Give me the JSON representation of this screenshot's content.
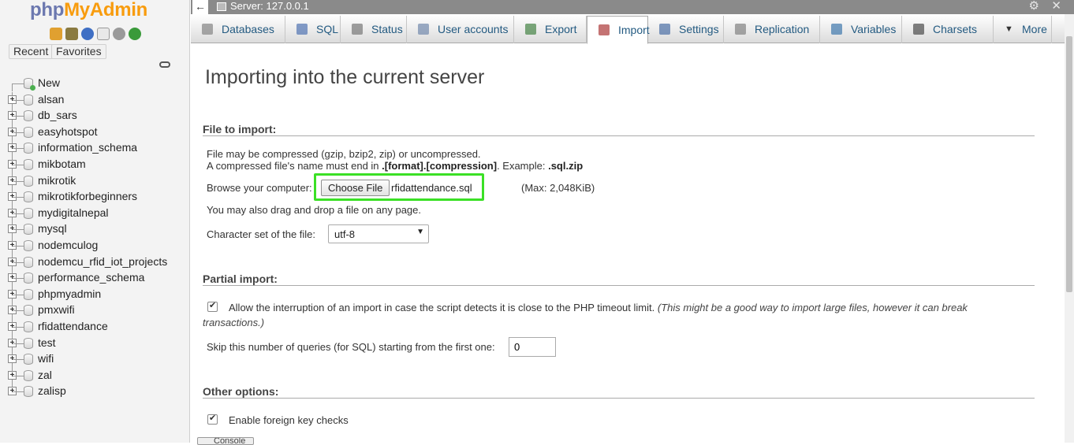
{
  "navigation": {
    "logo_part1": "php",
    "logo_part2": "MyAdmin",
    "icons": [
      "home-icon",
      "logout-icon",
      "help-icon",
      "docs-icon",
      "settings-icon",
      "reload-icon"
    ],
    "recent_label": "Recent",
    "favorites_label": "Favorites",
    "new_label": "New",
    "databases": [
      "alsan",
      "db_sars",
      "easyhotspot",
      "information_schema",
      "mikbotam",
      "mikrotik",
      "mikrotikforbeginners",
      "mydigitalnepal",
      "mysql",
      "nodemculog",
      "nodemcu_rfid_iot_projects",
      "performance_schema",
      "phpmyadmin",
      "pmxwifi",
      "rfidattendance",
      "test",
      "wifi",
      "zal",
      "zalisp"
    ]
  },
  "topbar": {
    "back": "←",
    "server_label": "Server: 127.0.0.1",
    "gear": "⚙",
    "close": "✕"
  },
  "tabs": [
    {
      "label": "Databases",
      "icon": "database-icon"
    },
    {
      "label": "SQL",
      "icon": "sql-icon"
    },
    {
      "label": "Status",
      "icon": "status-icon"
    },
    {
      "label": "User accounts",
      "icon": "users-icon"
    },
    {
      "label": "Export",
      "icon": "export-icon"
    },
    {
      "label": "Import",
      "icon": "import-icon",
      "active": true
    },
    {
      "label": "Settings",
      "icon": "wrench-icon"
    },
    {
      "label": "Replication",
      "icon": "replication-icon"
    },
    {
      "label": "Variables",
      "icon": "variables-icon"
    },
    {
      "label": "Charsets",
      "icon": "charsets-icon"
    },
    {
      "label": "More",
      "icon": "caret-down-icon"
    }
  ],
  "main": {
    "title": "Importing into the current server",
    "file_section": {
      "heading": "File to import:",
      "line1": "File may be compressed (gzip, bzip2, zip) or uncompressed.",
      "line2_a": "A compressed file's name must end in ",
      "line2_b": ".[format].[compression]",
      "line2_c": ". Example: ",
      "line2_d": ".sql.zip",
      "browse_label": "Browse your computer:",
      "choose_button": "Choose File",
      "file_name": "rfidattendance.sql",
      "max_size": "(Max: 2,048KiB)",
      "drag_hint": "You may also drag and drop a file on any page.",
      "charset_label": "Character set of the file:",
      "charset_value": "utf-8"
    },
    "partial_section": {
      "heading": "Partial import:",
      "allow_interrupt_text": "Allow the interruption of an import in case the script detects it is close to the PHP timeout limit.",
      "allow_interrupt_note_1": "(This might be a good way to import large files, however it can break",
      "allow_interrupt_note_2": "transactions.)",
      "allow_interrupt_checked": true,
      "skip_label": "Skip this number of queries (for SQL) starting from the first one:",
      "skip_value": "0"
    },
    "other_section": {
      "heading": "Other options:",
      "fk_label": "Enable foreign key checks",
      "fk_checked": true
    },
    "console_label": "Console"
  }
}
